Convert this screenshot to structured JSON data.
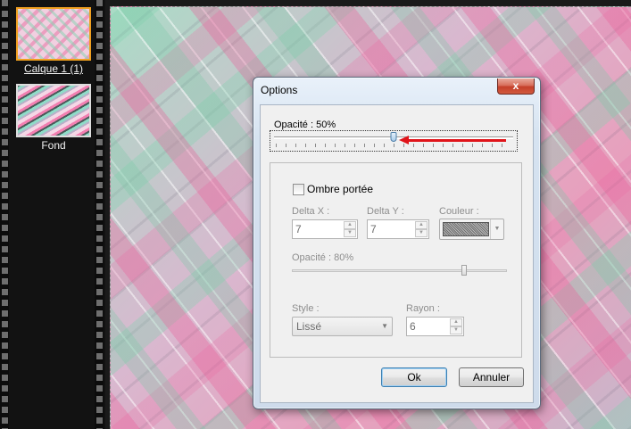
{
  "layers": {
    "items": [
      {
        "label": "Calque 1 (1)",
        "active": true
      },
      {
        "label": "Fond",
        "active": false
      }
    ]
  },
  "dialog": {
    "title": "Options",
    "close_label": "x",
    "opacity": {
      "label": "Opacité : 50%",
      "value_percent": 50
    },
    "shadow": {
      "checkbox_label": "Ombre portée",
      "checked": false,
      "delta_x": {
        "label": "Delta X :",
        "value": "7"
      },
      "delta_y": {
        "label": "Delta Y :",
        "value": "7"
      },
      "color": {
        "label": "Couleur :"
      },
      "opacity": {
        "label": "Opacité : 80%",
        "value_percent": 80
      },
      "style": {
        "label": "Style :",
        "value": "Lissé"
      },
      "radius": {
        "label": "Rayon :",
        "value": "6"
      }
    },
    "buttons": {
      "ok": "Ok",
      "cancel": "Annuler"
    }
  },
  "icons": {
    "spin_up": "▲",
    "spin_down": "▼",
    "dropdown": "▼"
  },
  "colors": {
    "accent_red": "#e0141a",
    "close_button": "#c4402a",
    "active_layer_border": "#f0a020"
  }
}
